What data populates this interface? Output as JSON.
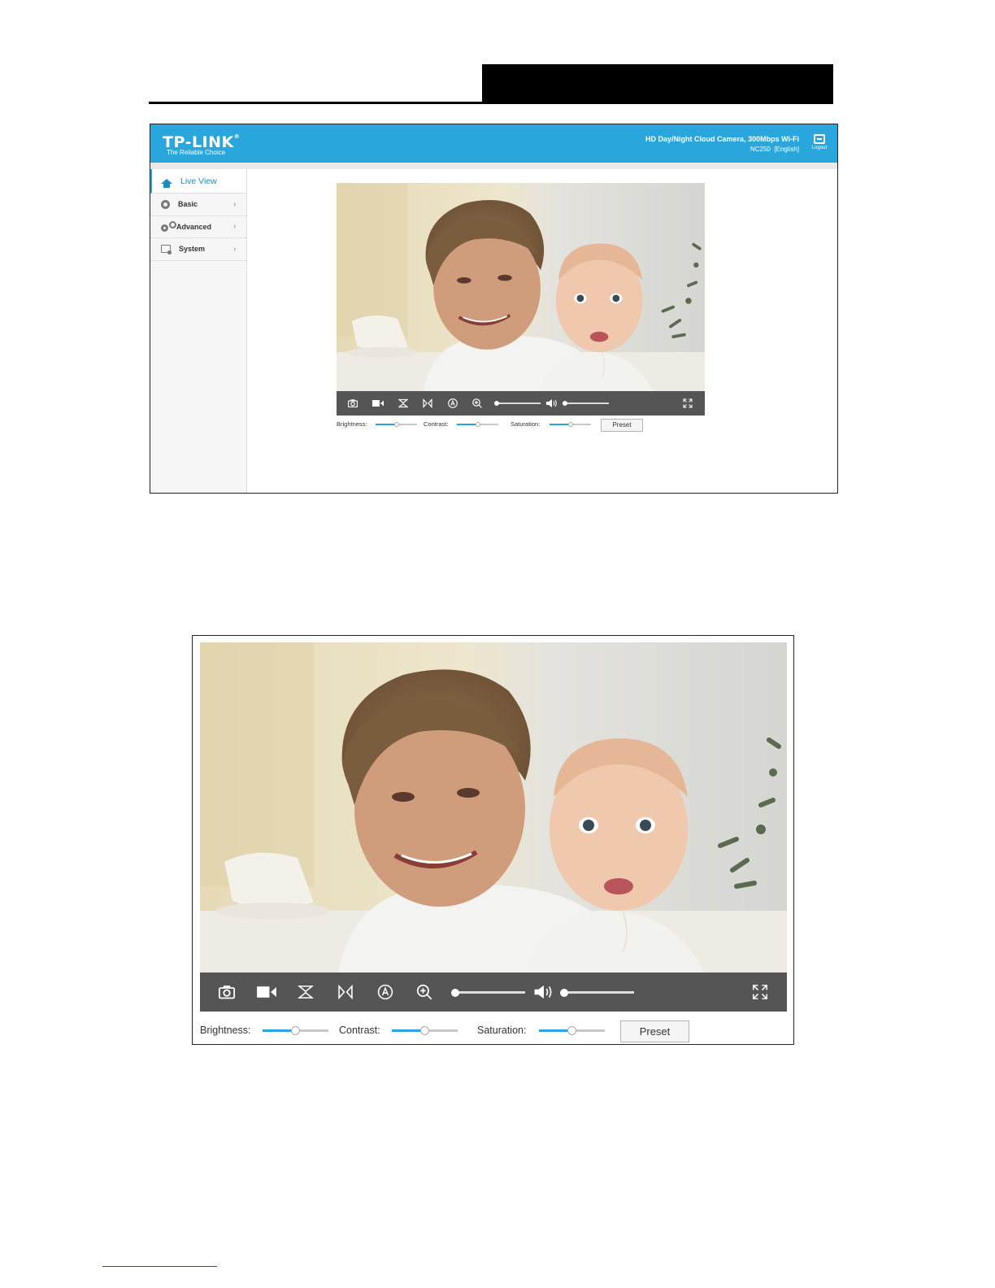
{
  "app": {
    "logo": "TP-LINK",
    "logo_mark": "®",
    "tagline": "The Reliable Choice",
    "product": "HD Day/Night Cloud Camera, 300Mbps Wi-Fi",
    "model_line": "NC250  [English]",
    "logout": "Logout"
  },
  "sidebar": {
    "items": [
      {
        "label": "Live View",
        "icon": "home-icon"
      },
      {
        "label": "Basic",
        "icon": "gear-icon"
      },
      {
        "label": "Advanced",
        "icon": "gears-icon"
      },
      {
        "label": "System",
        "icon": "system-icon"
      }
    ]
  },
  "controls": {
    "icons": [
      "camera-icon",
      "record-icon",
      "flip-icon",
      "mirror-icon",
      "auto-icon",
      "zoom-in-icon",
      "volume-icon",
      "fullscreen-icon"
    ],
    "zoom_level": 0,
    "volume_level": 0
  },
  "adjust": {
    "brightness": {
      "label": "Brightness:",
      "value": 50
    },
    "contrast": {
      "label": "Contrast:",
      "value": 50
    },
    "saturation": {
      "label": "Saturation:",
      "value": 50
    },
    "preset": "Preset"
  },
  "colors": {
    "accent": "#29a6dc",
    "control_bar": "#555555"
  }
}
